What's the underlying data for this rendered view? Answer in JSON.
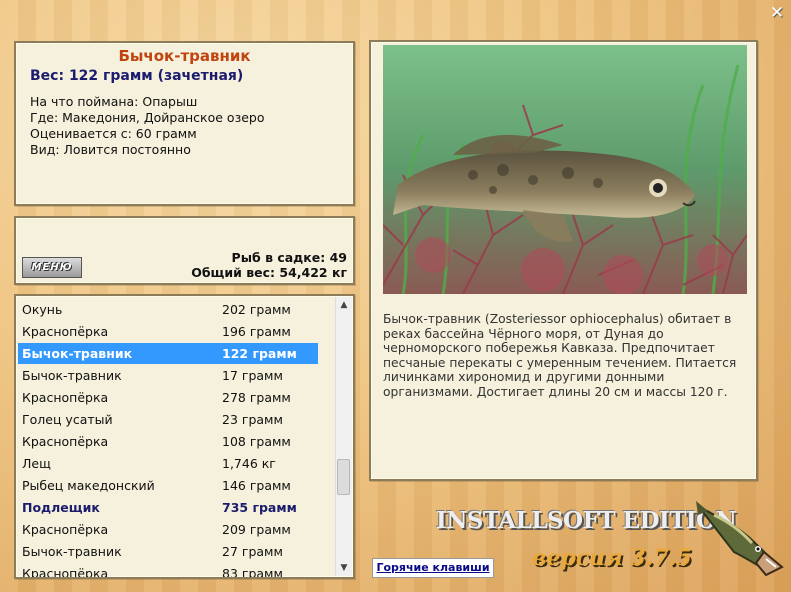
{
  "info": {
    "fish_name": "Бычок-травник",
    "weight": "Вес: 122 грамм (зачетная)",
    "bait": "На что поймана: Опарыш",
    "location": "Где: Македония, Дойранское озеро",
    "rated_from": "Оценивается с: 60 грамм",
    "kind": "Вид: Ловится постоянно"
  },
  "stats": {
    "logo_label": "МЕНЮ",
    "fish_count": "Рыб в садке: 49",
    "total_weight": "Общий вес: 54,422 кг"
  },
  "catch_list": [
    {
      "name": "Окунь",
      "weight": "202 грамм",
      "state": "normal"
    },
    {
      "name": "Краснопёрка",
      "weight": "196 грамм",
      "state": "normal"
    },
    {
      "name": "Бычок-травник",
      "weight": "122 грамм",
      "state": "selected"
    },
    {
      "name": "Бычок-травник",
      "weight": "17 грамм",
      "state": "normal"
    },
    {
      "name": "Краснопёрка",
      "weight": "278 грамм",
      "state": "normal"
    },
    {
      "name": "Голец усатый",
      "weight": "23 грамм",
      "state": "normal"
    },
    {
      "name": "Краснопёрка",
      "weight": "108 грамм",
      "state": "normal"
    },
    {
      "name": "Лещ",
      "weight": "1,746 кг",
      "state": "normal"
    },
    {
      "name": "Рыбец македонский",
      "weight": "146 грамм",
      "state": "normal"
    },
    {
      "name": "Подлещик",
      "weight": "735 грамм",
      "state": "highlighted"
    },
    {
      "name": "Краснопёрка",
      "weight": "209 грамм",
      "state": "normal"
    },
    {
      "name": "Бычок-травник",
      "weight": "27 грамм",
      "state": "normal"
    },
    {
      "name": "Краснопёрка",
      "weight": "83 грамм",
      "state": "normal"
    }
  ],
  "description": "Бычок-травник (Zosteriessor ophiocephalus) обитает в реках бассейна Чёрного моря, от Дуная до черноморского побережья Кавказа. Предпочитает песчаные перекаты с умеренным течением. Питается личинками хирономид и другими донными организмами. Достигает длины 20 см и массы 120 г.",
  "hotkeys_label": "Горячие клавиши",
  "branding": {
    "edition": "INSTALLSOFT EDITION",
    "version": "версия 3.7.5"
  },
  "icons": {
    "close": "close-icon",
    "scroll_up": "arrow-up-icon",
    "scroll_down": "arrow-down-icon",
    "mascot": "pike-fish-icon"
  },
  "colors": {
    "title": "#c1440e",
    "accent_text": "#1c1c6e",
    "selection": "#3399ff"
  }
}
